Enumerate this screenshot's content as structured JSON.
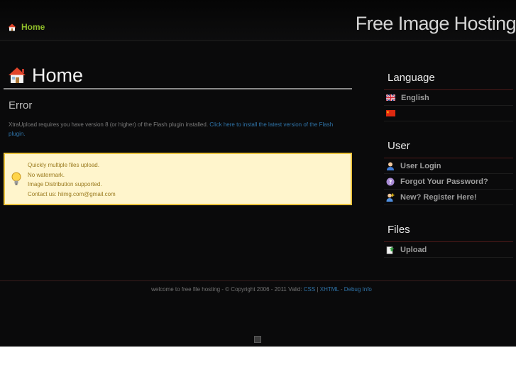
{
  "header": {
    "nav_home_label": "Home",
    "site_title": "Free Image Hosting"
  },
  "main": {
    "heading": "Home",
    "error_title": "Error",
    "error_message": "XtraUpload requires you have version 8 (or higher) of the Flash plugin installed.",
    "error_link": "Click here to install the latest version of the Flash plugin.",
    "info_lines": [
      "Quickly multiple files upload.",
      "No watermark.",
      "Image Distribution supported.",
      "Contact us: hiimg.com@gmail.com"
    ]
  },
  "sidebar": {
    "language_title": "Language",
    "languages": [
      {
        "label": "English",
        "icon": "uk-flag-icon"
      },
      {
        "label": "",
        "icon": "china-flag-icon"
      }
    ],
    "user_title": "User",
    "user_items": [
      {
        "label": "User Login",
        "icon": "user-icon"
      },
      {
        "label": "Forgot Your Password?",
        "icon": "help-icon"
      },
      {
        "label": "New? Register Here!",
        "icon": "add-user-icon"
      }
    ],
    "files_title": "Files",
    "file_items": [
      {
        "label": "Upload",
        "icon": "upload-icon"
      }
    ]
  },
  "footer": {
    "text": "welcome to free file hosting - © Copyright 2006 - 2011 Valid:",
    "css_link": "CSS",
    "separator": "|",
    "xhtml_link": "XHTML",
    "dash": "-",
    "debug_link": "Debug Info"
  },
  "colors": {
    "background": "#0a0a0b",
    "home_green": "#8fbd2a",
    "link_blue": "#2f74a9",
    "info_bg": "#fff5cc",
    "info_border": "#ebc33c",
    "sidebar_divider": "#4e1a1a"
  }
}
